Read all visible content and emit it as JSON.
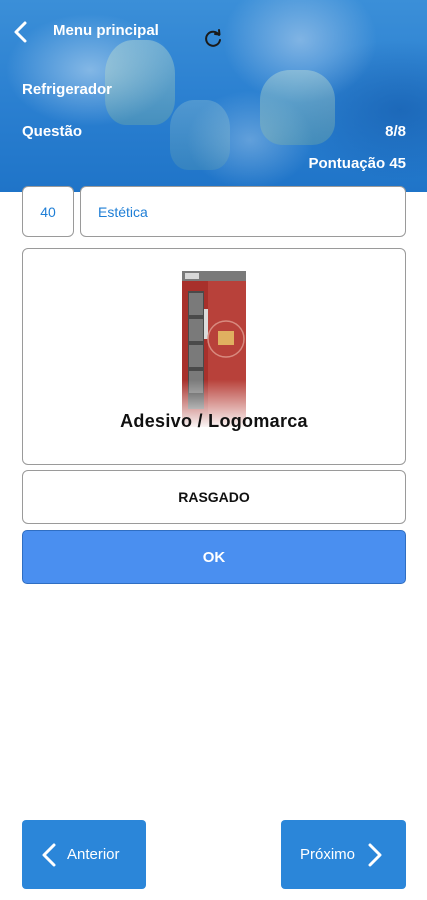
{
  "header": {
    "title": "Menu principal",
    "equipment": "Refrigerador",
    "question_label": "Questão",
    "question_progress": "8/8",
    "score": "Pontuação 45"
  },
  "item": {
    "number": "40",
    "category": "Estética",
    "image_label": "Adesivo / Logomarca",
    "answer": "RASGADO"
  },
  "actions": {
    "ok_label": "OK",
    "prev_label": "Anterior",
    "next_label": "Próximo"
  },
  "icons": {
    "back": "chevron-left-icon",
    "refresh": "refresh-icon",
    "prev": "chevron-left-icon",
    "next": "chevron-right-icon"
  },
  "colors": {
    "primary_blue": "#2b86d9",
    "ok_blue": "#4a8ff0",
    "text_blue": "#1e7ed6"
  }
}
